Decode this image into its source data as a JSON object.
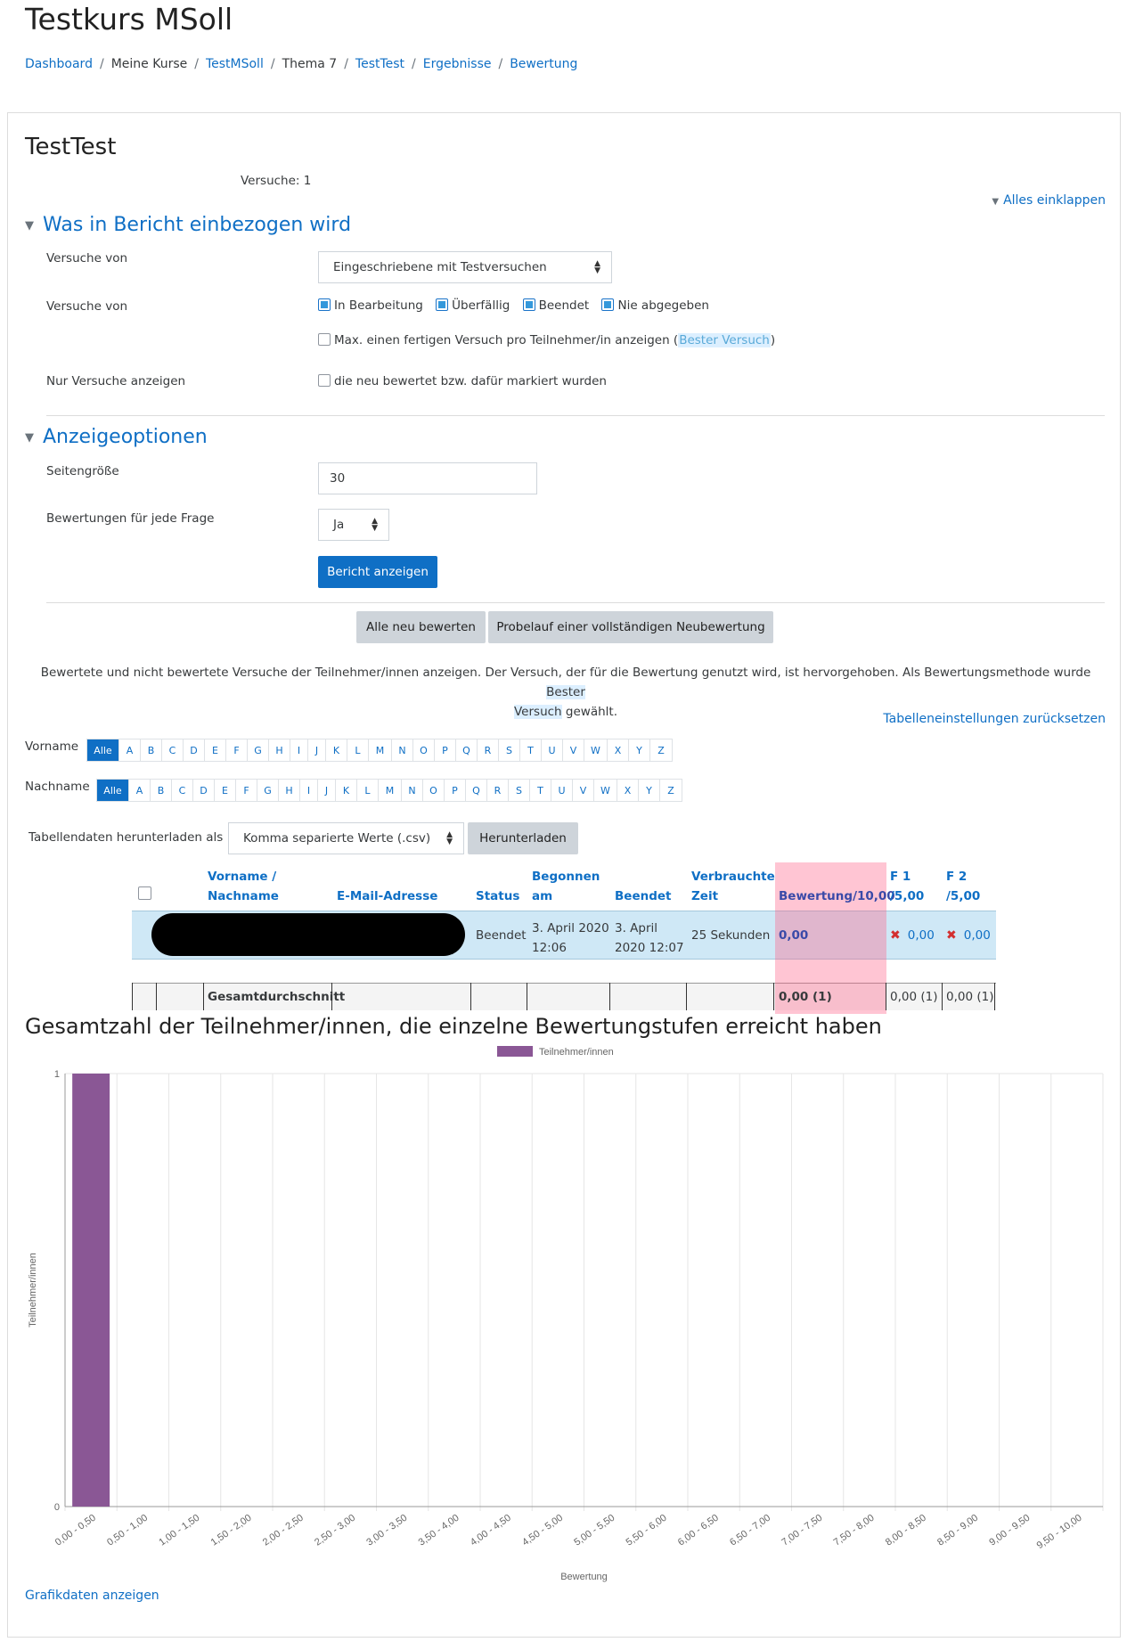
{
  "header": {
    "title": "Testkurs MSoll",
    "breadcrumb": [
      {
        "label": "Dashboard",
        "link": true
      },
      {
        "label": "Meine Kurse",
        "link": false
      },
      {
        "label": "TestMSoll",
        "link": true
      },
      {
        "label": "Thema 7",
        "link": false
      },
      {
        "label": "TestTest",
        "link": true
      },
      {
        "label": "Ergebnisse",
        "link": true
      },
      {
        "label": "Bewertung",
        "link": true
      }
    ]
  },
  "main": {
    "heading": "TestTest",
    "attempts": "Versuche: 1",
    "collapse_all": "Alles einklappen"
  },
  "section_report": {
    "legend": "Was in Bericht einbezogen wird",
    "attempts_from_label": "Versuche von",
    "attempts_from_value": "Eingeschriebene mit Testversuchen",
    "states_label": "Versuche von",
    "states": [
      {
        "label": "In Bearbeitung",
        "checked": true
      },
      {
        "label": "Überfällig",
        "checked": true
      },
      {
        "label": "Beendet",
        "checked": true
      },
      {
        "label": "Nie abgegeben",
        "checked": true
      }
    ],
    "one_attempt_prefix": "Max. einen fertigen Versuch pro Teilnehmer/in anzeigen (",
    "one_attempt_highlight": "Bester Versuch",
    "one_attempt_suffix": ")",
    "only_regraded_label": "Nur Versuche anzeigen",
    "only_regraded_text": "die neu bewertet bzw. dafür markiert wurden"
  },
  "section_display": {
    "legend": "Anzeigeoptionen",
    "pagesize_label": "Seitengröße",
    "pagesize_value": "30",
    "marks_label": "Bewertungen für jede Frage",
    "marks_value": "Ja",
    "submit": "Bericht anzeigen"
  },
  "buttons": {
    "regrade_all": "Alle neu bewerten",
    "dry_run": "Probelauf einer vollständigen Neubewertung"
  },
  "info": {
    "text1": "Bewertete und nicht bewertete Versuche der Teilnehmer/innen anzeigen. Der Versuch, der für die Bewertung genutzt wird, ist hervorgehoben. Als Bewertungsmethode wurde ",
    "highlight_a": "Bester",
    "highlight_b": "Versuch",
    "text2": " gewählt."
  },
  "reset_table": "Tabelleneinstellungen zurücksetzen",
  "initials": {
    "first_label": "Vorname",
    "last_label": "Nachname",
    "all": "Alle",
    "letters": [
      "A",
      "B",
      "C",
      "D",
      "E",
      "F",
      "G",
      "H",
      "I",
      "J",
      "K",
      "L",
      "M",
      "N",
      "O",
      "P",
      "Q",
      "R",
      "S",
      "T",
      "U",
      "V",
      "W",
      "X",
      "Y",
      "Z"
    ]
  },
  "download": {
    "label": "Tabellendaten herunterladen als",
    "format": "Komma separierte Werte (.csv)",
    "button": "Herunterladen"
  },
  "table": {
    "headers": {
      "name_a": "Vorname /",
      "name_b": "Nachname",
      "email": "E-Mail-Adresse",
      "status": "Status",
      "started_a": "Begonnen",
      "started_b": "am",
      "finished": "Beendet",
      "time_a": "Verbrauchte",
      "time_b": "Zeit",
      "grade": "Bewertung/10,00",
      "q1_a": "F 1",
      "q1_b": "/5,00",
      "q2_a": "F 2",
      "q2_b": "/5,00"
    },
    "row": {
      "status": "Beendet",
      "started_a": "3. April 2020",
      "started_b": "12:06",
      "finished_a": "3. April",
      "finished_b": "2020 12:07",
      "time": "25 Sekunden",
      "grade": "0,00",
      "q1": "0,00",
      "q2": "0,00"
    },
    "average": {
      "label": "Gesamtdurchschnitt",
      "grade": "0,00 (1)",
      "q1": "0,00 (1)",
      "q2": "0,00 (1)"
    }
  },
  "chart_data": {
    "type": "bar",
    "title": "Gesamtzahl der Teilnehmer/innen, die einzelne Bewertungstufen erreicht haben",
    "xlabel": "Bewertung",
    "ylabel": "Teilnehmer/innen",
    "categories": [
      "0,00 - 0,50",
      "0,50 - 1,00",
      "1,00 - 1,50",
      "1,50 - 2,00",
      "2,00 - 2,50",
      "2,50 - 3,00",
      "3,00 - 3,50",
      "3,50 - 4,00",
      "4,00 - 4,50",
      "4,50 - 5,00",
      "5,00 - 5,50",
      "5,50 - 6,00",
      "6,00 - 6,50",
      "6,50 - 7,00",
      "7,00 - 7,50",
      "7,50 - 8,00",
      "8,00 - 8,50",
      "8,50 - 9,00",
      "9,00 - 9,50",
      "9,50 - 10,00"
    ],
    "series": [
      {
        "name": "Teilnehmer/innen",
        "values": [
          1,
          0,
          0,
          0,
          0,
          0,
          0,
          0,
          0,
          0,
          0,
          0,
          0,
          0,
          0,
          0,
          0,
          0,
          0,
          0
        ],
        "color": "#8a5795"
      }
    ],
    "ylim": [
      0,
      1
    ],
    "yticks": [
      0,
      1
    ],
    "grid": true,
    "legend": "top-center"
  },
  "graph_link": "Grafikdaten anzeigen"
}
